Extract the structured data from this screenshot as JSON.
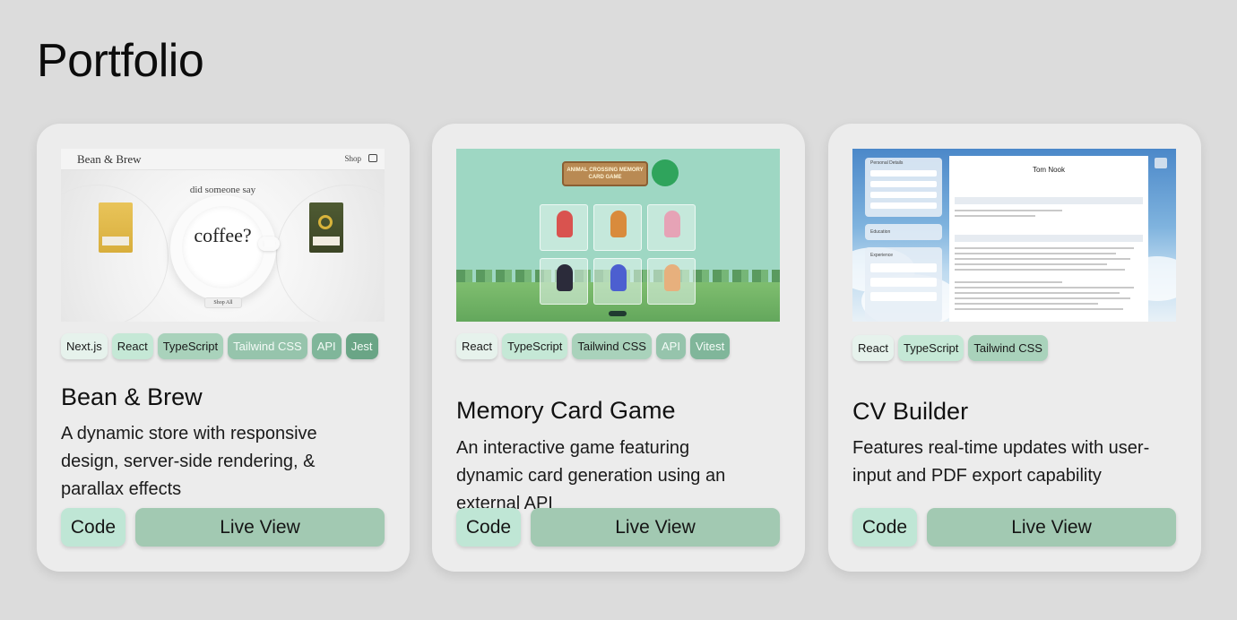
{
  "page": {
    "title": "Portfolio"
  },
  "colors": {
    "background": "#dcdcdc",
    "card": "#ececec",
    "code_button": "#bfe6d5",
    "live_button": "#a2c9b2"
  },
  "projects": [
    {
      "title": "Bean & Brew",
      "description": "A dynamic store with responsive design, server-side rendering, & parallax effects",
      "tags": [
        {
          "label": "Next.js",
          "color": "#e6f2ec"
        },
        {
          "label": "React",
          "color": "#c5e8d6"
        },
        {
          "label": "TypeScript",
          "color": "#a9d2bb"
        },
        {
          "label": "Tailwind CSS",
          "color": "#96c4ac"
        },
        {
          "label": "API",
          "color": "#80b69a"
        },
        {
          "label": "Jest",
          "color": "#6aa586"
        }
      ],
      "code_label": "Code",
      "live_label": "Live View",
      "screenshot": {
        "logo": "Bean & Brew",
        "nav_link": "Shop",
        "tagline": "did someone say",
        "headline": "coffee?",
        "button": "Shop All"
      }
    },
    {
      "title": "Memory Card Game",
      "description": "An interactive game featuring dynamic card generation using an external API",
      "tags": [
        {
          "label": "React",
          "color": "#e6f2ec"
        },
        {
          "label": "TypeScript",
          "color": "#c5e8d6"
        },
        {
          "label": "Tailwind CSS",
          "color": "#a9d2bb"
        },
        {
          "label": "API",
          "color": "#96c4ac"
        },
        {
          "label": "Vitest",
          "color": "#80b69a"
        }
      ],
      "code_label": "Code",
      "live_label": "Live View",
      "screenshot": {
        "board": "ANIMAL CROSSING MEMORY CARD GAME"
      }
    },
    {
      "title": "CV Builder",
      "description": "Features real-time updates with user-input and PDF export capability",
      "tags": [
        {
          "label": "React",
          "color": "#e6f2ec"
        },
        {
          "label": "TypeScript",
          "color": "#c5e8d6"
        },
        {
          "label": "Tailwind CSS",
          "color": "#a9d2bb"
        }
      ],
      "code_label": "Code",
      "live_label": "Live View",
      "screenshot": {
        "name": "Tom Nook",
        "section_personal": "Personal Details",
        "section_education": "Education",
        "section_experience": "Experience"
      }
    }
  ]
}
